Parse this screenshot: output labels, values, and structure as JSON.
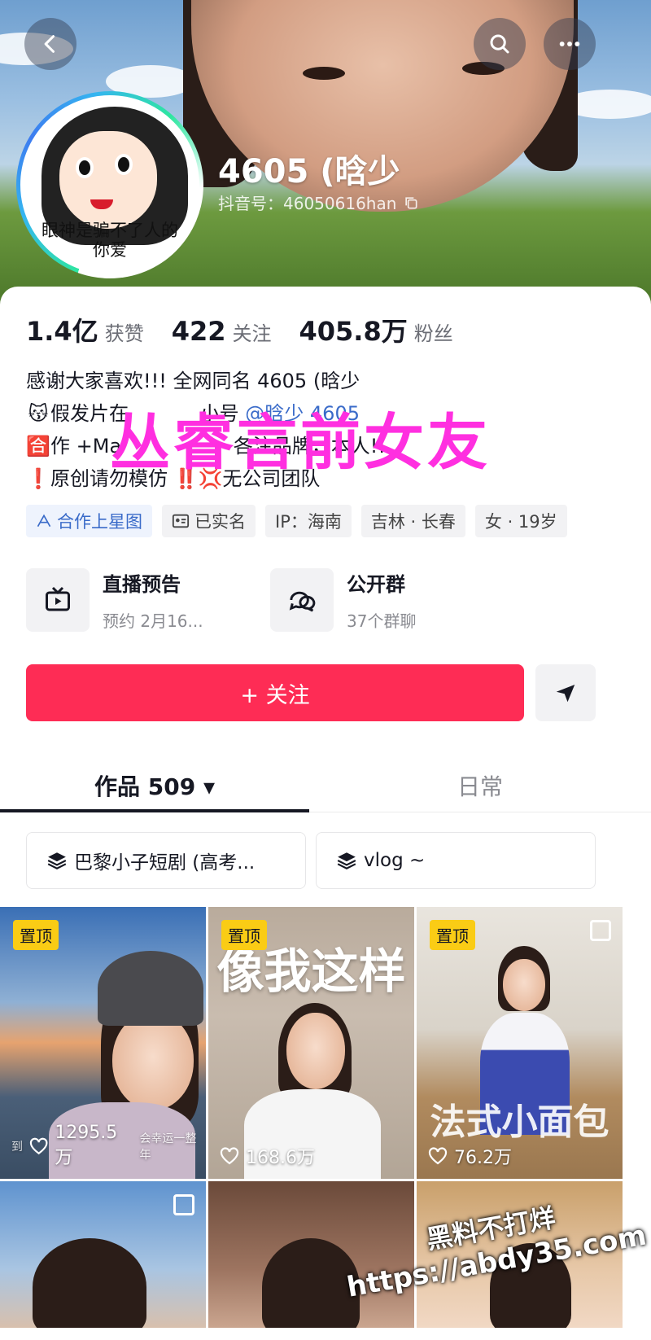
{
  "header": {
    "nickname": "4605 (晗少",
    "douyin_id": "抖音号：46050616han",
    "avatar_caption_line1": "眼神是骗不了人的",
    "avatar_caption_line2": "你爱"
  },
  "stats": [
    {
      "value": "1.4亿",
      "label": "获赞"
    },
    {
      "value": "422",
      "label": "关注"
    },
    {
      "value": "405.8万",
      "label": "粉丝"
    }
  ],
  "bio": {
    "line1": "感谢大家喜欢!!!  全网同名 4605 (晗少",
    "line2_emoji": "😽",
    "line2_text": "假发片在",
    "line2_mid": "小号",
    "line2_link": "@晗少 4605",
    "line3_emoji": "🈴",
    "line3_text": "作 +Ma",
    "line3_tail": "各注品牌，本人!!",
    "line4_emoji": "❗",
    "line4_text": "原创请勿模仿",
    "line4_emoji2": "‼️💢",
    "line4_tail": "无公司团队",
    "overlay_text": "丛睿言前女友"
  },
  "tags": [
    {
      "label": "合作上星图",
      "icon": "star-map-icon"
    },
    {
      "label": "已实名",
      "icon": "id-card-icon"
    },
    {
      "label": "IP：海南"
    },
    {
      "label": "吉林 · 长春"
    },
    {
      "label": "女 · 19岁"
    }
  ],
  "features": [
    {
      "title": "直播预告",
      "subtitle": "预约 2月16...",
      "icon": "tv-icon"
    },
    {
      "title": "公开群",
      "subtitle": "37个群聊",
      "icon": "chat-bubbles-icon"
    }
  ],
  "actions": {
    "follow_label": "+ 关注",
    "follow_color": "#fe2c55"
  },
  "tabs": [
    {
      "label": "作品 509 ▾",
      "active": true
    },
    {
      "label": "日常",
      "active": false
    }
  ],
  "collections": [
    {
      "label": "巴黎小子短剧 (高考...",
      "icon": "layers-icon"
    },
    {
      "label": "vlog ~",
      "icon": "layers-icon"
    }
  ],
  "videos": [
    {
      "pinned": "置顶",
      "likes": "1295.5万",
      "caption": "到",
      "caption_tail": "会幸运一整年"
    },
    {
      "pinned": "置顶",
      "likes": "168.6万",
      "overlay": "像我这样"
    },
    {
      "pinned": "置顶",
      "likes": "76.2万",
      "overlay": "法式小面包"
    },
    {},
    {},
    {}
  ],
  "site_watermark": {
    "line1": "黑料不打烊",
    "line2": "https://abdy35.com"
  }
}
